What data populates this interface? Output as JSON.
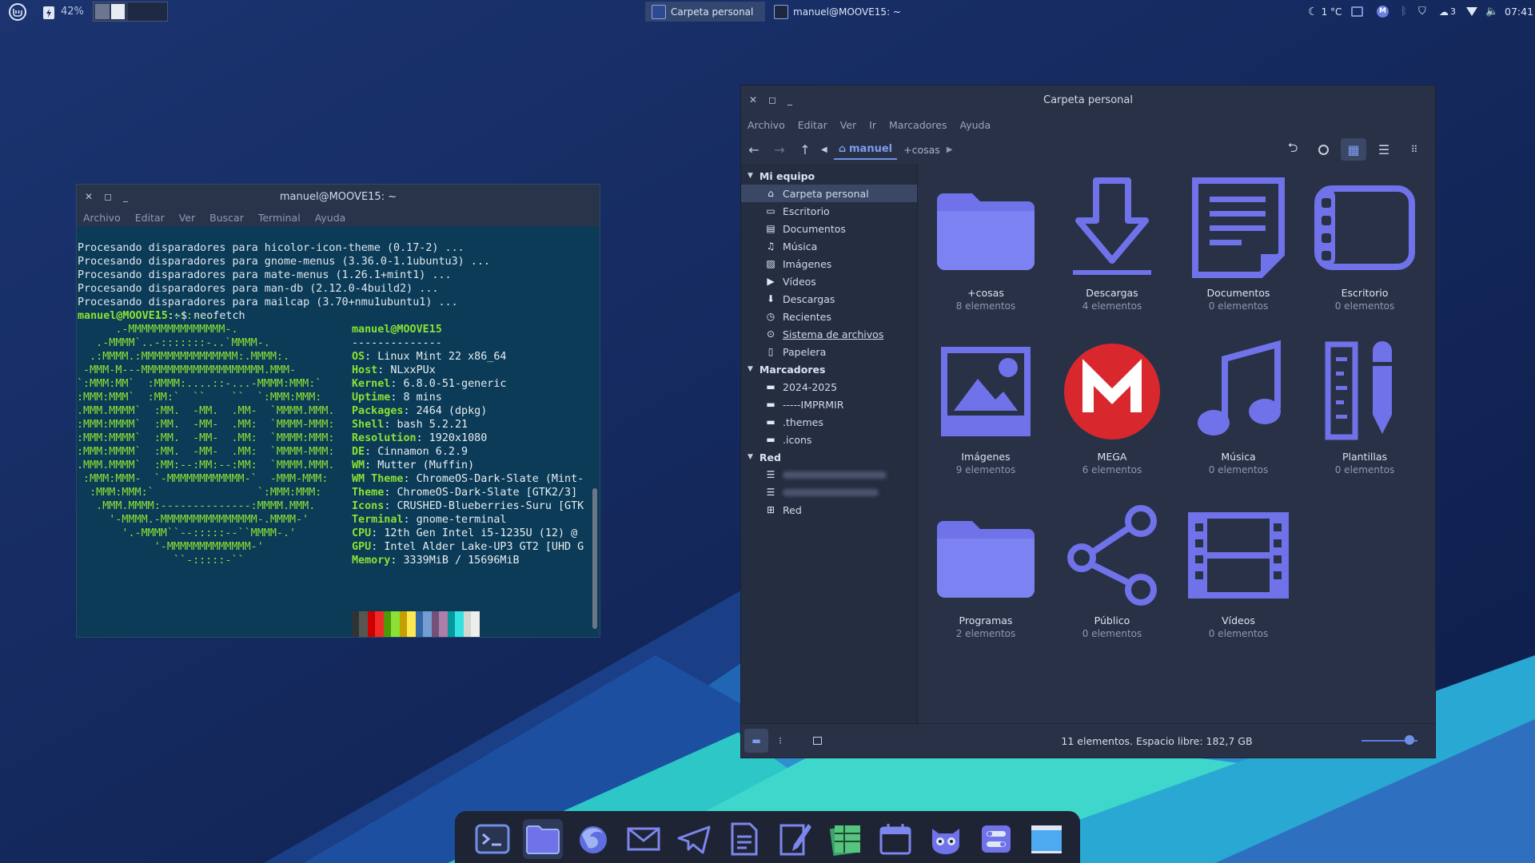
{
  "topbar": {
    "battery_percent": "42%",
    "tasks": [
      {
        "label": "Carpeta personal",
        "active": true
      },
      {
        "label": "manuel@MOOVE15: ~",
        "active": false
      }
    ],
    "weather": "1 °C",
    "badge_count": "3",
    "clock": "07:41"
  },
  "terminal": {
    "title": "manuel@MOOVE15: ~",
    "menu": [
      "Archivo",
      "Editar",
      "Ver",
      "Buscar",
      "Terminal",
      "Ayuda"
    ],
    "log_lines": [
      "Procesando disparadores para hicolor-icon-theme (0.17-2) ...",
      "Procesando disparadores para gnome-menus (3.36.0-1.1ubuntu3) ...",
      "Procesando disparadores para mate-menus (1.26.1+mint1) ...",
      "Procesando disparadores para man-db (2.12.0-4build2) ...",
      "Procesando disparadores para mailcap (3.70+nmu1ubuntu1) ..."
    ],
    "prompt_user": "manuel@MOOVE15",
    "prompt_suffix": ":~$ ",
    "command": "neofetch",
    "ascii_art": "         ...-:::::-...\n      .-MMMMMMMMMMMMMMM-.\n   .-MMMM`..-:::::::-..`MMMM-.\n  .:MMMM.:MMMMMMMMMMMMMMM:.MMMM:.\n -MMM-M---MMMMMMMMMMMMMMMMMMM.MMM-\n`:MMM:MM`  :MMMM:....::-...-MMMM:MMM:`\n:MMM:MMM`  :MM:`  ``    ``  `:MMM:MMM:\n.MMM.MMMM`  :MM.  -MM.  .MM-  `MMMM.MMM.\n:MMM:MMMM`  :MM.  -MM-  .MM:  `MMMM-MMM:\n:MMM:MMMM`  :MM.  -MM-  .MM:  `MMMM:MMM:\n:MMM:MMMM`  :MM.  -MM-  .MM:  `MMMM-MMM:\n.MMM.MMMM`  :MM:--:MM:--:MM:  `MMMM.MMM.\n :MMM:MMM-  `-MMMMMMMMMMMM-`  -MMM-MMM:\n  :MMM:MMM:`                `:MMM:MMM:\n   .MMM.MMMM:--------------:MMMM.MMM.\n     '-MMMM.-MMMMMMMMMMMMMMM-.MMMM-'\n       '.-MMMM``--:::::--``MMMM-.'\n            '-MMMMMMMMMMMMM-'\n               ``-:::::-``",
    "neofetch_header": "manuel@MOOVE15",
    "neofetch_separator": "--------------",
    "neofetch": [
      {
        "key": "OS",
        "value": "Linux Mint 22 x86_64"
      },
      {
        "key": "Host",
        "value": "NLxxPUx"
      },
      {
        "key": "Kernel",
        "value": "6.8.0-51-generic"
      },
      {
        "key": "Uptime",
        "value": "8 mins"
      },
      {
        "key": "Packages",
        "value": "2464 (dpkg)"
      },
      {
        "key": "Shell",
        "value": "bash 5.2.21"
      },
      {
        "key": "Resolution",
        "value": "1920x1080"
      },
      {
        "key": "DE",
        "value": "Cinnamon 6.2.9"
      },
      {
        "key": "WM",
        "value": "Mutter (Muffin)"
      },
      {
        "key": "WM Theme",
        "value": "ChromeOS-Dark-Slate (Mint-"
      },
      {
        "key": "Theme",
        "value": "ChromeOS-Dark-Slate [GTK2/3]"
      },
      {
        "key": "Icons",
        "value": "CRUSHED-Blueberries-Suru [GTK"
      },
      {
        "key": "Terminal",
        "value": "gnome-terminal"
      },
      {
        "key": "CPU",
        "value": "12th Gen Intel i5-1235U (12) @"
      },
      {
        "key": "GPU",
        "value": "Intel Alder Lake-UP3 GT2 [UHD G"
      },
      {
        "key": "Memory",
        "value": "3339MiB / 15696MiB"
      }
    ],
    "palette": [
      "#2e3436",
      "#cc0000",
      "#4e9a06",
      "#c4a000",
      "#3465a4",
      "#75507b",
      "#06989a",
      "#d3d7cf",
      "#555753",
      "#ef2929",
      "#8ae234",
      "#fce94f",
      "#729fcf",
      "#ad7fa8",
      "#34e2e2",
      "#eeeeec"
    ]
  },
  "filemanager": {
    "title": "Carpeta personal",
    "menu": [
      "Archivo",
      "Editar",
      "Ver",
      "Ir",
      "Marcadores",
      "Ayuda"
    ],
    "breadcrumb": {
      "home": "manuel",
      "next": "+cosas"
    },
    "sidebar": {
      "sections": [
        {
          "header": "Mi equipo",
          "items": [
            {
              "label": "Carpeta personal",
              "icon": "home-icon",
              "selected": true
            },
            {
              "label": "Escritorio",
              "icon": "desktop-icon"
            },
            {
              "label": "Documentos",
              "icon": "document-icon"
            },
            {
              "label": "Música",
              "icon": "music-icon"
            },
            {
              "label": "Imágenes",
              "icon": "image-icon"
            },
            {
              "label": "Vídeos",
              "icon": "video-icon"
            },
            {
              "label": "Descargas",
              "icon": "download-icon"
            },
            {
              "label": "Recientes",
              "icon": "recent-icon"
            },
            {
              "label": "Sistema de archivos",
              "icon": "drive-icon"
            },
            {
              "label": "Papelera",
              "icon": "trash-icon"
            }
          ]
        },
        {
          "header": "Marcadores",
          "items": [
            {
              "label": "2024-2025",
              "icon": "folder-icon"
            },
            {
              "label": "-----IMPRMIR",
              "icon": "folder-icon"
            },
            {
              "label": ".themes",
              "icon": "folder-icon"
            },
            {
              "label": ".icons",
              "icon": "folder-icon"
            }
          ]
        },
        {
          "header": "Red",
          "items": [
            {
              "label": "",
              "icon": "network-share-icon",
              "blurred": true
            },
            {
              "label": "",
              "icon": "network-share-icon",
              "blurred": true
            },
            {
              "label": "Red",
              "icon": "network-icon"
            }
          ]
        }
      ]
    },
    "items": [
      {
        "name": "+cosas",
        "count": "8 elementos",
        "icon": "folder-icon"
      },
      {
        "name": "Descargas",
        "count": "4 elementos",
        "icon": "download-icon"
      },
      {
        "name": "Documentos",
        "count": "0 elementos",
        "icon": "document-icon"
      },
      {
        "name": "Escritorio",
        "count": "0 elementos",
        "icon": "desktop-icon"
      },
      {
        "name": "Imágenes",
        "count": "9 elementos",
        "icon": "image-icon"
      },
      {
        "name": "MEGA",
        "count": "6 elementos",
        "icon": "mega-icon"
      },
      {
        "name": "Música",
        "count": "0 elementos",
        "icon": "music-icon"
      },
      {
        "name": "Plantillas",
        "count": "0 elementos",
        "icon": "templates-icon"
      },
      {
        "name": "Programas",
        "count": "2 elementos",
        "icon": "folder-icon"
      },
      {
        "name": "Público",
        "count": "0 elementos",
        "icon": "share-icon"
      },
      {
        "name": "Vídeos",
        "count": "0 elementos",
        "icon": "video-icon"
      }
    ],
    "status": "11 elementos. Espacio libre: 182,7 GB",
    "zoom_level": 0.85
  },
  "dock": {
    "apps": [
      "terminal-icon",
      "file-manager-icon",
      "firefox-icon",
      "mail-icon",
      "telegram-icon",
      "text-editor-icon",
      "notes-icon",
      "spreadsheet-icon",
      "calendar-icon",
      "gimp-icon",
      "settings-icon",
      "desktop-show-icon"
    ]
  },
  "colors": {
    "accent": "#6f8fe6",
    "icon_fill": "#6f72e8",
    "terminal_bg": "#0b3b57",
    "prompt_green": "#8ae234",
    "mega_red": "#d9272e"
  }
}
